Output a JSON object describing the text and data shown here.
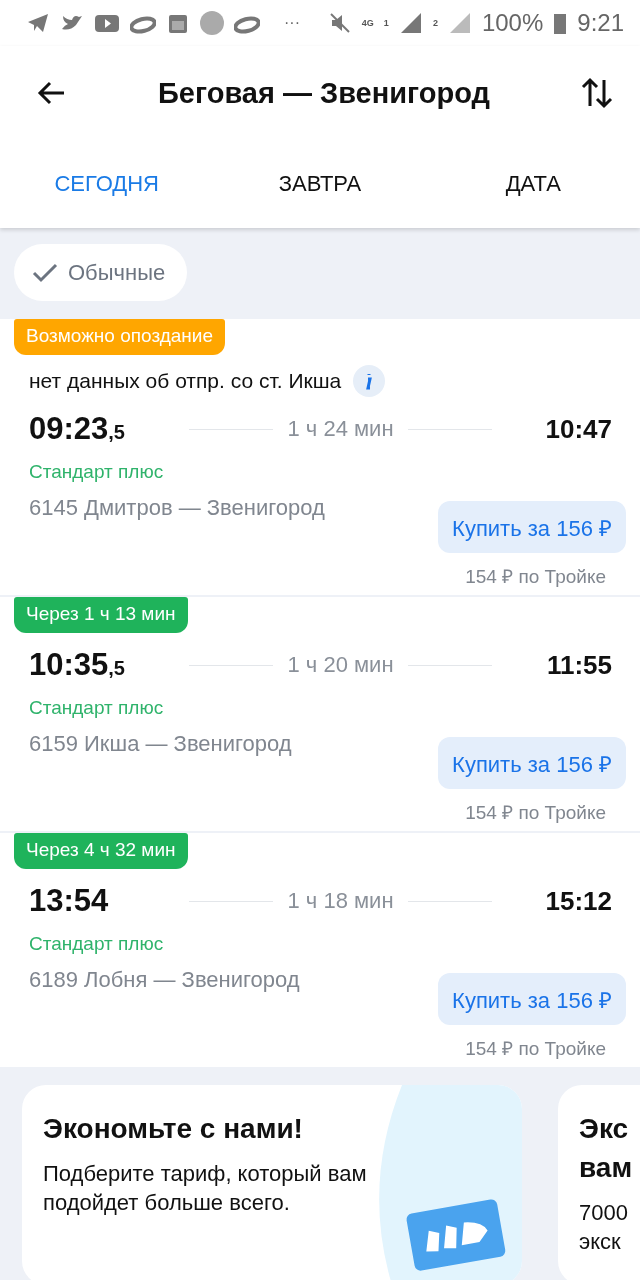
{
  "status_bar": {
    "battery": "100%",
    "time": "9:21",
    "network": "4G",
    "sim_1": "1",
    "sim_2": "2",
    "more": "···"
  },
  "header": {
    "title": "Беговая — Звенигород"
  },
  "tabs": [
    {
      "label": "СЕГОДНЯ",
      "selected": true
    },
    {
      "label": "ЗАВТРА",
      "selected": false
    },
    {
      "label": "ДАТА",
      "selected": false
    }
  ],
  "filter": {
    "label": "Обычные",
    "checked": true
  },
  "trains": [
    {
      "badge": "Возможно опоздание",
      "color": "#ffa600",
      "note": "нет данных об отпр. со ст. Икша",
      "departure": "09:23",
      "departure_fraction": ",5",
      "duration": "1 ч 24 мин",
      "arrival": "10:47",
      "fare_class": "Стандарт плюс",
      "route": "6145 Дмитров — Звенигород",
      "buy": "Купить за 156 ₽",
      "troika": "154 ₽ по Тройке"
    },
    {
      "badge": "Через 1 ч 13 мин",
      "color": "#1fb35b",
      "departure": "10:35",
      "departure_fraction": ",5",
      "duration": "1 ч 20 мин",
      "arrival": "11:55",
      "fare_class": "Стандарт плюс",
      "route": "6159 Икша — Звенигород",
      "buy": "Купить за 156 ₽",
      "troika": "154 ₽ по Тройке"
    },
    {
      "badge": "Через 4 ч 32 мин",
      "color": "#1fb35b",
      "departure": "13:54",
      "duration": "1 ч 18 мин",
      "arrival": "15:12",
      "fare_class": "Стандарт плюс",
      "route": "6189 Лобня — Звенигород",
      "buy": "Купить за 156 ₽",
      "troika": "154 ₽ по Тройке"
    }
  ],
  "promos": [
    {
      "title": "Экономьте с нами!",
      "text": "Подберите тариф, который вам\nподойдет больше всего.",
      "kind": "ticket"
    },
    {
      "title": "Экс\nвам",
      "text": "7000\nэкск",
      "kind": "plain"
    }
  ]
}
